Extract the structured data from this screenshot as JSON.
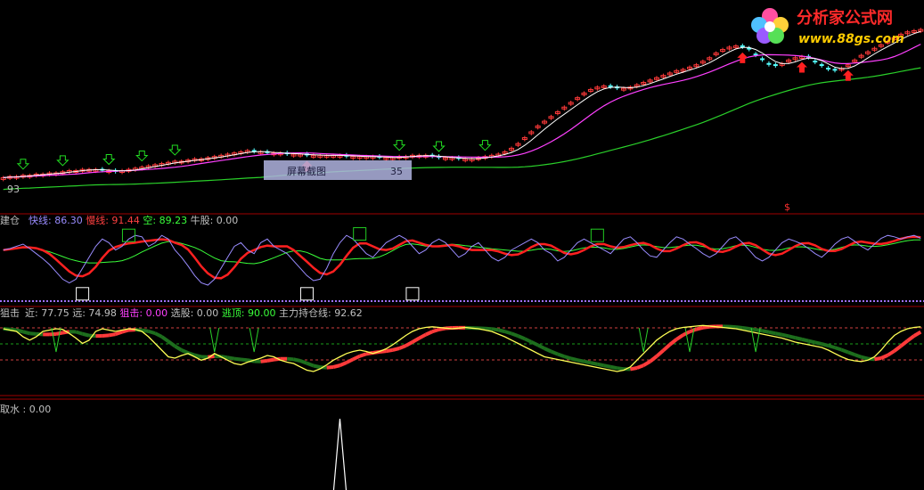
{
  "colors": {
    "background": "#000000",
    "divider": "#a00000",
    "up_candle": "#ff3a3a",
    "down_candle": "#54ffff",
    "ma_short": "#ffffff",
    "ma_mid": "#ff40ff",
    "ma_long": "#2ad02a",
    "fast_line": "#9a8cff",
    "slow_line": "#ff2020",
    "empty_line": "#3aff3a",
    "yellow_line": "#ffff55",
    "dark_green_band": "#1d6e1d",
    "box_green": "#22cc22",
    "box_white": "#ffffff",
    "arrow_up": "#ff2020",
    "arrow_down": "#22dd22"
  },
  "watermark": {
    "brand": "分析家公式网",
    "url": "www.88gs.com"
  },
  "main_panel": {
    "left_price_tick": "93",
    "tooltip_label": "屏幕截图",
    "tooltip_value": "35",
    "dollar_marker": "$"
  },
  "panel2": {
    "title": "建仓",
    "items": [
      {
        "label": "快线: ",
        "value": "86.30",
        "color": "#9a8cff"
      },
      {
        "label": "慢线: ",
        "value": "91.44",
        "color": "#ff4040"
      },
      {
        "label": "空: ",
        "value": "89.23",
        "color": "#3aff3a"
      },
      {
        "label": "牛股: ",
        "value": "0.00",
        "color": "#c0c0c0"
      }
    ]
  },
  "panel3": {
    "title": "狙击",
    "items": [
      {
        "label": "近: ",
        "value": "77.75",
        "color": "#c0c0c0"
      },
      {
        "label": "远: ",
        "value": "74.98",
        "color": "#c0c0c0"
      },
      {
        "label": "狙击: ",
        "value": "0.00",
        "color": "#ff40ff"
      },
      {
        "label": "选股: ",
        "value": "0.00",
        "color": "#c0c0c0"
      },
      {
        "label": "逃顶: ",
        "value": "90.00",
        "color": "#3aff3a"
      },
      {
        "label": "主力持仓线: ",
        "value": "92.62",
        "color": "#c0c0c0"
      }
    ]
  },
  "panel4": {
    "title": "取水",
    "sep": " : ",
    "value": "0.00"
  },
  "chart_data": {
    "type": "candlestick_indicator",
    "bars": 140,
    "main_price_series": [
      8,
      9,
      9,
      10,
      10,
      11,
      11,
      12,
      12,
      13,
      14,
      14,
      15,
      15,
      15,
      14,
      14,
      13,
      14,
      15,
      16,
      17,
      18,
      19,
      20,
      21,
      22,
      22,
      23,
      24,
      24,
      25,
      26,
      27,
      28,
      29,
      30,
      31,
      30,
      30,
      29,
      29,
      29,
      28,
      28,
      28,
      27,
      27,
      27,
      27,
      27,
      27,
      26,
      26,
      26,
      26,
      26,
      25,
      25,
      25,
      26,
      26,
      27,
      27,
      27,
      26,
      25,
      25,
      25,
      24,
      24,
      24,
      25,
      26,
      27,
      28,
      30,
      33,
      37,
      42,
      47,
      52,
      56,
      60,
      64,
      68,
      72,
      76,
      80,
      83,
      85,
      86,
      85,
      84,
      84,
      85,
      87,
      89,
      91,
      93,
      95,
      97,
      99,
      100,
      102,
      104,
      107,
      110,
      114,
      117,
      119,
      120,
      119,
      117,
      112,
      108,
      104,
      103,
      105,
      108,
      110,
      111,
      110,
      106,
      103,
      100,
      99,
      101,
      104,
      108,
      112,
      115,
      118,
      121,
      124,
      127,
      130,
      132,
      133,
      134
    ],
    "panel2_fast_line": [
      70,
      72,
      75,
      78,
      72,
      65,
      58,
      50,
      40,
      30,
      25,
      30,
      45,
      60,
      75,
      85,
      80,
      70,
      75,
      85,
      90,
      88,
      75,
      80,
      90,
      85,
      70,
      60,
      48,
      35,
      25,
      22,
      30,
      45,
      60,
      75,
      80,
      70,
      65,
      80,
      85,
      75,
      70,
      65,
      55,
      45,
      35,
      28,
      30,
      45,
      65,
      80,
      90,
      85,
      75,
      65,
      60,
      70,
      80,
      85,
      90,
      85,
      75,
      65,
      70,
      80,
      85,
      80,
      70,
      60,
      65,
      75,
      80,
      70,
      60,
      55,
      60,
      70,
      75,
      80,
      85,
      80,
      70,
      65,
      55,
      60,
      70,
      80,
      85,
      80,
      75,
      70,
      65,
      75,
      85,
      88,
      80,
      70,
      62,
      60,
      70,
      80,
      88,
      85,
      78,
      72,
      65,
      60,
      65,
      75,
      85,
      88,
      80,
      70,
      60,
      55,
      60,
      70,
      80,
      85,
      82,
      78,
      72,
      65,
      60,
      68,
      78,
      85,
      88,
      82,
      75,
      70,
      78,
      86,
      90,
      88,
      85,
      88,
      90,
      86
    ],
    "panel3_yellow_line": [
      92,
      90,
      88,
      80,
      75,
      80,
      88,
      90,
      92,
      91,
      85,
      78,
      70,
      75,
      88,
      92,
      90,
      88,
      90,
      92,
      91,
      88,
      80,
      70,
      60,
      50,
      48,
      52,
      55,
      50,
      45,
      48,
      55,
      50,
      45,
      40,
      38,
      42,
      45,
      48,
      52,
      50,
      45,
      42,
      40,
      35,
      30,
      28,
      32,
      38,
      45,
      50,
      55,
      58,
      60,
      58,
      55,
      58,
      62,
      68,
      75,
      82,
      88,
      92,
      94,
      95,
      94,
      93,
      92,
      93,
      94,
      93,
      92,
      90,
      88,
      84,
      80,
      75,
      70,
      65,
      60,
      55,
      50,
      48,
      46,
      44,
      42,
      40,
      38,
      36,
      34,
      32,
      30,
      28,
      30,
      35,
      45,
      55,
      65,
      75,
      82,
      88,
      92,
      94,
      95,
      96,
      97,
      96,
      95,
      94,
      93,
      92,
      90,
      88,
      86,
      84,
      82,
      80,
      78,
      75,
      72,
      70,
      68,
      66,
      64,
      60,
      55,
      50,
      46,
      44,
      43,
      45,
      50,
      60,
      72,
      82,
      88,
      92,
      94,
      95
    ],
    "panel4_spike_bar": 51,
    "panel4_spike_value": 100
  }
}
